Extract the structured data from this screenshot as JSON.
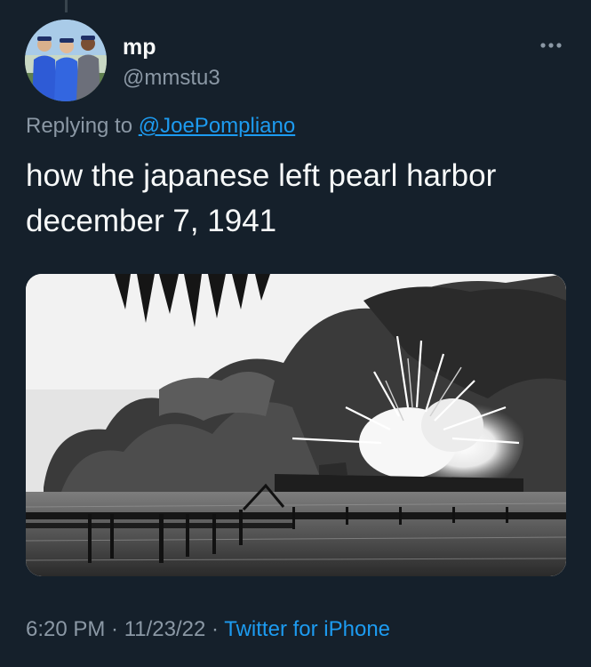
{
  "user": {
    "name": "mp",
    "handle": "@mmstu3"
  },
  "reply": {
    "prefix": "Replying to",
    "mention": "@JoePompliano"
  },
  "tweet": {
    "line1": "how the japanese left pearl harbor",
    "line2": "december 7, 1941"
  },
  "meta": {
    "time": "6:20 PM",
    "separator1": " · ",
    "date": "11/23/22",
    "separator2": " · ",
    "source": "Twitter for iPhone"
  },
  "colors": {
    "background": "#15202b",
    "text_primary": "#f7f9f9",
    "text_secondary": "#8b98a5",
    "accent": "#1d9bf0"
  },
  "icons": {
    "more": "more-horizontal-icon"
  }
}
